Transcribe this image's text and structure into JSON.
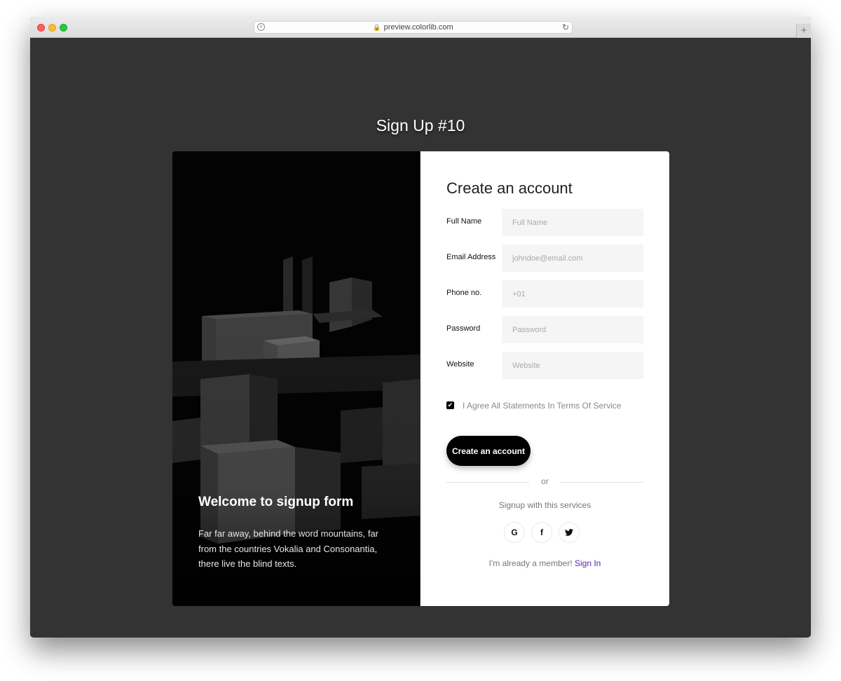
{
  "browser": {
    "url": "preview.colorlib.com",
    "new_tab_label": "+"
  },
  "page": {
    "title": "Sign Up #10"
  },
  "hero": {
    "heading": "Welcome to signup form",
    "text": "Far far away, behind the word mountains, far from the countries Vokalia and Consonantia, there live the blind texts."
  },
  "form": {
    "title": "Create an account",
    "fields": [
      {
        "label": "Full Name",
        "placeholder": "Full Name",
        "value": ""
      },
      {
        "label": "Email Address",
        "placeholder": "johndoe@email.com",
        "value": ""
      },
      {
        "label": "Phone no.",
        "placeholder": "+01",
        "value": ""
      },
      {
        "label": "Password",
        "placeholder": "Password",
        "value": ""
      },
      {
        "label": "Website",
        "placeholder": "Website",
        "value": ""
      }
    ],
    "agree_label": "I Agree All Statements In Terms Of Service",
    "agree_checked": true,
    "submit_label": "Create an account",
    "or_label": "or",
    "services_label": "Signup with this services",
    "social": [
      {
        "name": "google-icon",
        "glyph": "G"
      },
      {
        "name": "facebook-icon",
        "glyph": "f"
      },
      {
        "name": "twitter-icon",
        "glyph": "t"
      }
    ],
    "member_text": "I'm already a member!",
    "signin_label": "Sign In"
  },
  "colors": {
    "background": "#333333",
    "accent_link": "#5a1fb8",
    "button": "#000000"
  }
}
